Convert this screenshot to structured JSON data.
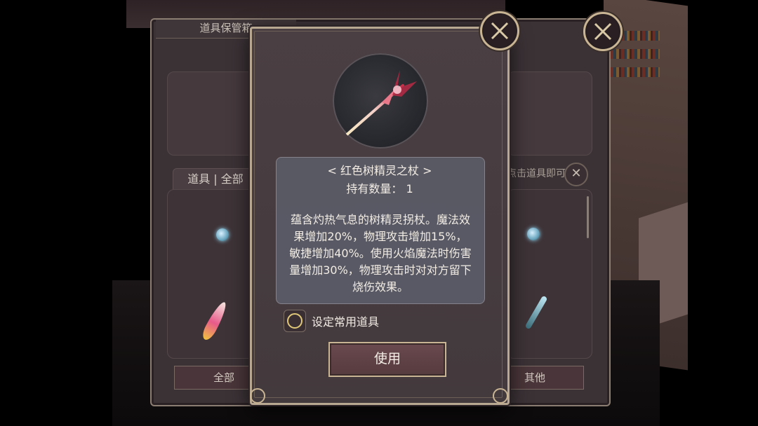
{
  "background_panel": {
    "title": "道具保管箱",
    "tab_label": "道具 | 全部",
    "use_hint": "点击道具即可使用",
    "bottom_tabs": {
      "left": "全部",
      "right": "其他"
    }
  },
  "item_detail": {
    "name": "< 红色树精灵之杖 >",
    "quantity_label": "持有数量： 1",
    "description": "蕴含灼热气息的树精灵拐杖。魔法效果增加20%，物理攻击增加15%，敏捷增加40%。使用火焰魔法时伤害量增加30%，物理攻击时对对方留下烧伤效果。",
    "favorite_label": "设定常用道具",
    "favorite_checked": false,
    "use_button_label": "使用"
  },
  "icons": {
    "close": "close-icon",
    "item": "red-treant-staff-icon"
  },
  "colors": {
    "frame_gold": "#c9b594",
    "panel_bg": "#4a3f43",
    "desc_bg": "#5a5b66",
    "checkbox_ring": "#e0c878"
  }
}
